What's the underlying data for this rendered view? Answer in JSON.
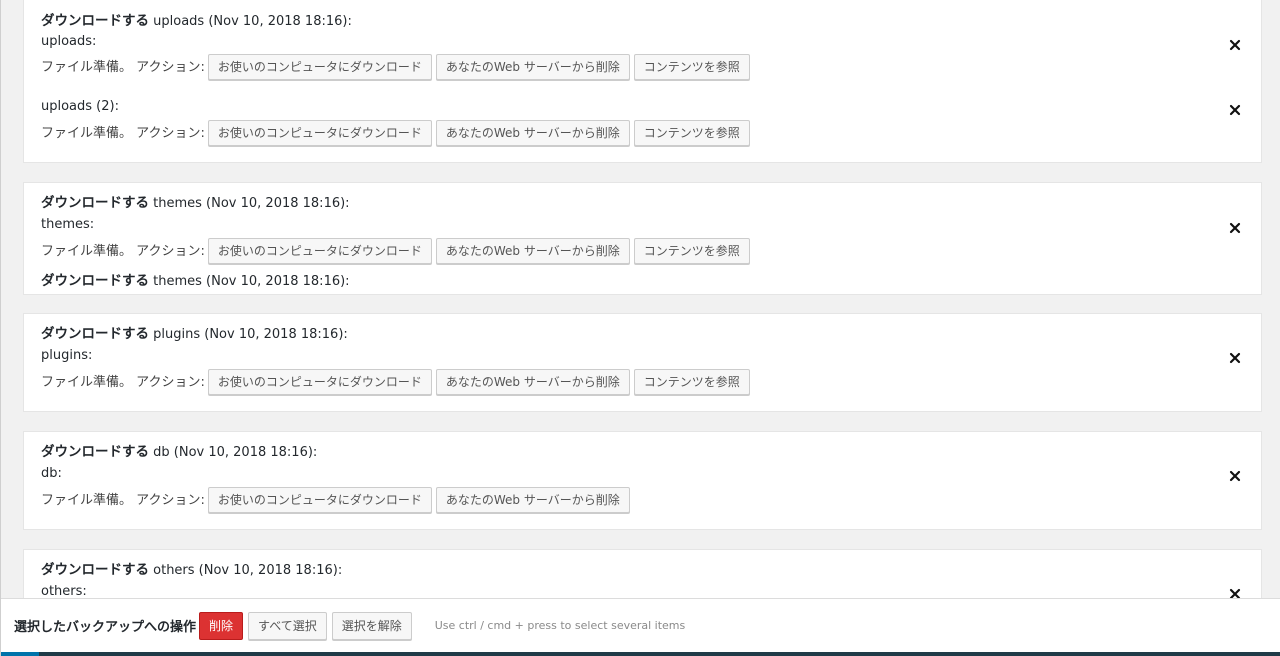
{
  "common": {
    "status_text": "ファイル準備。 アクション:",
    "download_button": "お使いのコンピュータにダウンロード",
    "delete_button": "あなたのWeb サーバーから削除",
    "view_button": "コンテンツを参照",
    "download_prefix": "ダウンロードする"
  },
  "panels": [
    {
      "heading_suffix": "uploads (Nov 10, 2018 18:16):",
      "entities": [
        {
          "label": "uploads:"
        },
        {
          "label": "uploads (2):"
        }
      ]
    },
    {
      "heading_suffix": "themes (Nov 10, 2018 18:16):",
      "entities": [
        {
          "label": "themes:"
        }
      ],
      "trailing_heading_suffix": "themes (Nov 10, 2018 18:16):"
    },
    {
      "heading_suffix": "plugins (Nov 10, 2018 18:16):",
      "entities": [
        {
          "label": "plugins:"
        }
      ]
    },
    {
      "heading_suffix": "db (Nov 10, 2018 18:16):",
      "entities": [
        {
          "label": "db:"
        }
      ]
    },
    {
      "heading_suffix": "others (Nov 10, 2018 18:16):",
      "entities": [
        {
          "label": "others:"
        }
      ]
    }
  ],
  "bulk_actions": {
    "label": "選択したバックアップへの操作",
    "delete_button": "削除",
    "select_all_button": "すべて選択",
    "deselect_button": "選択を解除",
    "hint": "Use ctrl / cmd + press to select several items"
  },
  "icons": {
    "close": "close-icon"
  },
  "colors": {
    "danger": "#dc3232",
    "page_background": "#f1f1f1",
    "admin_bar": "#1f3a47",
    "accent": "#0073aa"
  }
}
